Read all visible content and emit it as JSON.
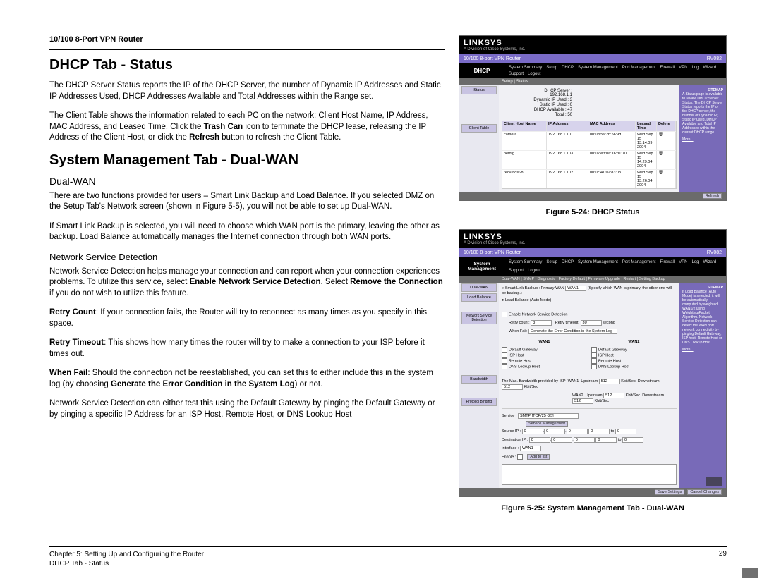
{
  "doc_header": "10/100 8-Port VPN Router",
  "h1_dhcp": "DHCP Tab - Status",
  "p1": "The DHCP Server Status reports the IP of the DHCP Server, the number of Dynamic IP Addresses and Static IP Addresses Used, DHCP Addresses Available and Total Addresses within the Range set.",
  "p2a": "The Client Table shows the information related to each PC on the network: Client Host Name, IP Address, MAC Address, and Leased Time. Click the ",
  "p2b": "Trash Can",
  "p2c": " icon to terminate the DHCP lease, releasing the IP Address of the Client Host, or click the ",
  "p2d": "Refresh",
  "p2e": " button to refresh the Client Table.",
  "h1_sysman": "System Management Tab - Dual-WAN",
  "h2_dualwan": "Dual-WAN",
  "p3": "There are two functions provided for users – Smart Link Backup and Load Balance. If you selected DMZ on the Setup Tab's Network screen (shown in Figure 5-5), you will not be able to set up Dual-WAN.",
  "p4": "If Smart Link Backup is selected, you will need to choose which WAN port is the primary, leaving the other as backup. Load Balance automatically manages the Internet connection through both WAN ports.",
  "h3_nsd": "Network Service Detection",
  "p5a": "Network Service Detection helps manage your connection and can report when your connection experiences problems. To utilize this service, select ",
  "p5b": "Enable Network Service Detection",
  "p5c": ". Select ",
  "p5d": "Remove the Connection",
  "p5e": " if you do not wish to utilize this feature.",
  "p6a": "Retry Count",
  "p6b": ": If your connection fails, the Router will try to reconnect as many times as you specify in this space.",
  "p7a": "Retry Timeout",
  "p7b": ": This shows how many times the router will try to make a connection to your ISP before it times out.",
  "p8a": "When Fail",
  "p8b": ": Should the connection not be reestablished, you can set this to either include this in the system log (by choosing ",
  "p8c": "Generate the Error Condition in the System Log",
  "p8d": ") or not.",
  "p9": "Network Service Detection can either test this using the Default Gateway by pinging the Default Gateway or by pinging a specific IP Address for an ISP Host, Remote Host, or DNS Lookup Host",
  "fig24": "Figure 5-24: DHCP Status",
  "fig25": "Figure 5-25: System Management Tab - Dual-WAN",
  "footer": {
    "chapter": "Chapter 5: Setting Up and Configuring the Router",
    "section": "DHCP Tab - Status",
    "page": "29"
  },
  "ss1": {
    "brand": "LINKSYS",
    "brand_sub": "A Division of Cisco Systems, Inc.",
    "title": "10/100 8-port VPN Router",
    "model": "RV082",
    "main_tab": "DHCP",
    "tabs": [
      "System Summary",
      "Setup",
      "DHCP",
      "System Management",
      "Port Management",
      "Firewall",
      "VPN",
      "Log",
      "Wizard",
      "Support",
      "Logout"
    ],
    "subtabs": "Setup  |  Status",
    "side": [
      "Status",
      "",
      "Client Table"
    ],
    "stats": {
      "server": "DHCP Server : 192.168.1.1",
      "dyn": "Dynamic IP Used : 3",
      "static": "Static IP Used : 0",
      "avail": "DHCP Available : 47",
      "total": "Total : 50"
    },
    "thead": [
      "Client Host Name",
      "IP Address",
      "MAC Address",
      "Leased Time",
      "Delete"
    ],
    "rows": [
      [
        "camera",
        "192.168.1.101",
        "00:0d:56:2b:56:9d",
        "Wed Sep 15 13:14:09 2004",
        ""
      ],
      [
        "netdig",
        "192.168.1.103",
        "00:02:e3:0a:16:31:70",
        "Wed Sep 15 14:29:04 2004",
        ""
      ],
      [
        "recv-host-8",
        "192.168.1.102",
        "00:0c:41:02:83:03",
        "Wed Sep 15 13:26:04 2004",
        ""
      ]
    ],
    "refresh": "Refresh",
    "help_title": "SITEMAP",
    "help": "A Status page is available to review DHCP Server Status. The DHCP Server Status reports the IP of the DHCP server, the number of Dynamic IP, Static IP Used, DHCP Available and Total IP Addresses within the current DHCP range.",
    "more": "More..."
  },
  "ss2": {
    "brand": "LINKSYS",
    "brand_sub": "A Division of Cisco Systems, Inc.",
    "title": "10/100 8-port VPN Router",
    "model": "RV082",
    "main_tab": "System Management",
    "tabs": [
      "System Summary",
      "Setup",
      "DHCP",
      "System Management",
      "Port Management",
      "Firewall",
      "VPN",
      "Log",
      "Wizard",
      "Support",
      "Logout"
    ],
    "subtabs": "Dual-WAN | SNMP | Diagnostic | Factory Default | Firmware Upgrade | Restart | Setting Backup",
    "side": [
      "Dual-WAN",
      "Load Balance",
      "",
      "Network Service Detection",
      "",
      "",
      "",
      "Bandwidth",
      "",
      "Protocol Binding"
    ],
    "mode1": "Smart Link Backup : Primary WAN",
    "mode1_sel": "WAN1",
    "mode1_note": "(Specify which WAN is primary, the other one will be backup.)",
    "mode2": "Load Balance (Auto Mode)",
    "nsd_enable": "Enable Network Service Detection",
    "retry_count": "Retry count:",
    "retry_count_v": "3",
    "retry_timeout": "Retry timeout:",
    "retry_timeout_v": "30",
    "retry_timeout_u": "second",
    "when_fail": "When Fail:",
    "when_fail_sel": "Generate the Error Condition in the System Log",
    "wan1": "WAN1",
    "wan2": "WAN2",
    "opts": [
      "Default Gateway",
      "ISP Host",
      "Remote Host",
      "DNS Lookup Host"
    ],
    "bw_label": "The Max. Bandwidth provided by ISP",
    "bw_wan": "WAN1",
    "bw_up": "Upstream",
    "bw_down": "Downstream",
    "bw_u": "Kbit/Sec",
    "bw_v1": "512",
    "bw_v2": "512",
    "bw_wan2": "WAN2",
    "pb_service": "Service :",
    "pb_service_sel": "SMTP [TCP/25~25]",
    "pb_svcmgmt": "Service Management",
    "pb_src": "Source IP :",
    "pb_dst": "Destination IP :",
    "pb_to": "to",
    "pb_iface": "Interface :",
    "pb_iface_sel": "WAN1",
    "pb_enable": "Enable :",
    "pb_add": "Add to list",
    "save": "Save Settings",
    "cancel": "Cancel Changes",
    "help_title": "SITEMAP",
    "help": "If Load Balance (Auto Mode) is selected, it will be automatically computed by weighted WAN1/2 using Weighting/Packet Algorithm. Network Service Detection can detect the WAN port network connectivity by pinging Default Gateway, ISP host, Remote Host or DNS Lookup Host.",
    "more": "More..."
  }
}
